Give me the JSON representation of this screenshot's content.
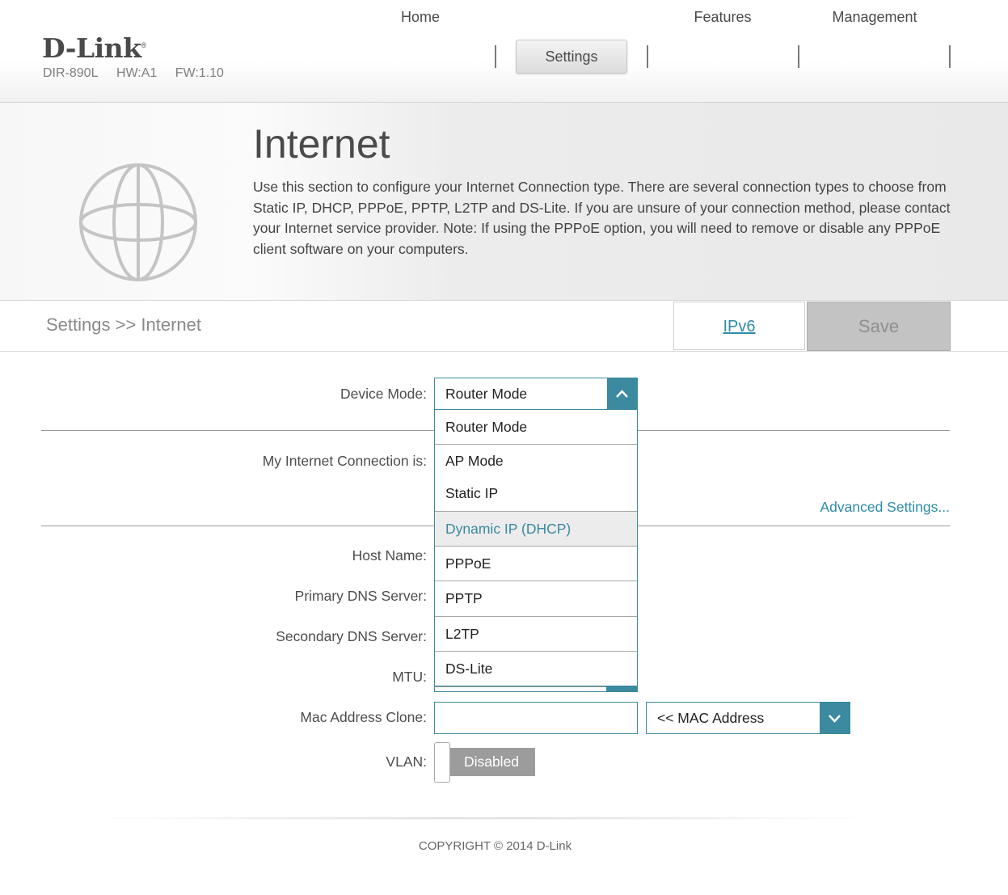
{
  "header": {
    "logo": "D-Link",
    "logo_mark": "®",
    "model": "DIR-890L",
    "hw": "HW:A1",
    "fw": "FW:1.10",
    "nav": [
      {
        "label": "Home",
        "active": false
      },
      {
        "label": "Settings",
        "active": true
      },
      {
        "label": "Features",
        "active": false
      },
      {
        "label": "Management",
        "active": false
      }
    ]
  },
  "banner": {
    "icon": "globe-icon",
    "title": "Internet",
    "description": "Use this section to configure your Internet Connection type. There are several connection types to choose from Static IP, DHCP, PPPoE, PPTP, L2TP and DS-Lite. If you are unsure of your connection method, please contact your Internet service provider. Note: If using the PPPoE option, you will need to remove or disable any PPPoE client software on your computers."
  },
  "toolbar": {
    "breadcrumb": "Settings >> Internet",
    "ipv6_label": "IPv6",
    "save_label": "Save"
  },
  "form": {
    "device_mode": {
      "label": "Device Mode:",
      "value": "Router Mode"
    },
    "connection": {
      "label": "My Internet Connection is:"
    },
    "advanced_link": "Advanced Settings...",
    "host_name": {
      "label": "Host Name:"
    },
    "primary_dns": {
      "label": "Primary DNS Server:"
    },
    "secondary_dns": {
      "label": "Secondary DNS Server:"
    },
    "mtu": {
      "label": "MTU:"
    },
    "mac_clone": {
      "label": "Mac Address Clone:",
      "input_value": "",
      "select_value": "<< MAC Address"
    },
    "vlan": {
      "label": "VLAN:",
      "state": "Disabled"
    }
  },
  "dropdown": {
    "items": [
      "Router Mode",
      "AP Mode",
      "Static IP",
      "Dynamic IP (DHCP)",
      "PPPoE",
      "PPTP",
      "L2TP",
      "DS-Lite"
    ],
    "highlighted": "Dynamic IP (DHCP)"
  },
  "footer": {
    "copyright": "COPYRIGHT © 2014 D-Link"
  },
  "colors": {
    "accent": "#3b8aa0",
    "link": "#2d8ca7",
    "save_bg": "#c3c3c3",
    "toggle_off": "#9c9c9c"
  }
}
